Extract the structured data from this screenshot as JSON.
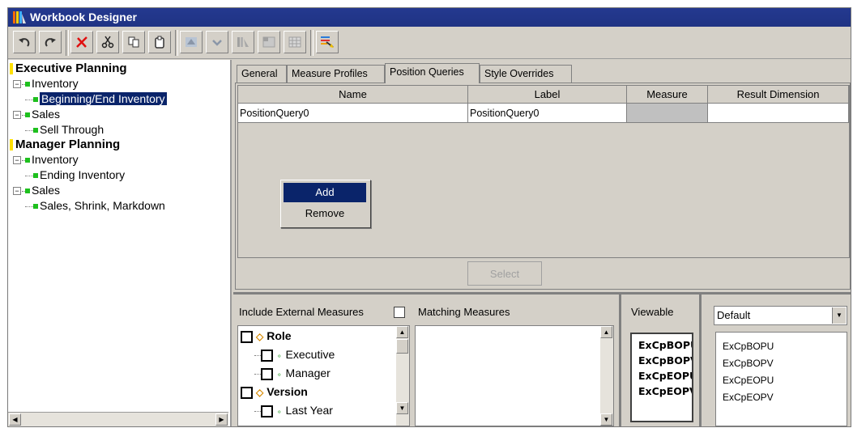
{
  "window": {
    "title": "Workbook Designer"
  },
  "toolbar": {
    "buttons": [
      "undo-icon",
      "redo-icon",
      "delete-icon",
      "cut-icon",
      "copy-icon",
      "paste-icon",
      "move-up-icon",
      "move-down-icon",
      "library-icon",
      "layout-icon",
      "grid-icon",
      "measure-icon"
    ]
  },
  "tree": {
    "items": [
      {
        "label": "Executive Planning",
        "level": 0
      },
      {
        "label": "Inventory",
        "level": 1
      },
      {
        "label": "Beginning/End Inventory",
        "level": 2
      },
      {
        "label": "Sales",
        "level": 1
      },
      {
        "label": "Sell Through",
        "level": 2
      },
      {
        "label": "Manager Planning",
        "level": 0
      },
      {
        "label": "Inventory",
        "level": 1
      },
      {
        "label": "Ending Inventory",
        "level": 2
      },
      {
        "label": "Sales",
        "level": 1
      },
      {
        "label": "Sales, Shrink, Markdown",
        "level": 2
      }
    ]
  },
  "tabs": [
    "General",
    "Measure Profiles",
    "Position Queries",
    "Style Overrides"
  ],
  "active_tab": "Position Queries",
  "grid": {
    "columns": [
      "Name",
      "Label",
      "Measure",
      "Result Dimension"
    ],
    "rows": [
      [
        "PositionQuery0",
        "PositionQuery0",
        "",
        ""
      ]
    ]
  },
  "context_menu": {
    "items": [
      "Add",
      "Remove"
    ]
  },
  "select_button": "Select",
  "bottom": {
    "include_external": "Include External Measures",
    "matching_measures": "Matching Measures",
    "viewable": "Viewable",
    "role_tree": [
      {
        "label": "Role",
        "level": 0
      },
      {
        "label": "Executive",
        "level": 1
      },
      {
        "label": "Manager",
        "level": 1
      },
      {
        "label": "Version",
        "level": 0
      },
      {
        "label": "Last Year",
        "level": 1
      }
    ],
    "viewable_items": [
      "ExCpBOPU",
      "ExCpBOPV",
      "ExCpEOPU",
      "ExCpEOPV"
    ],
    "profile_combo": "Default",
    "profile_items": [
      "ExCpBOPU",
      "ExCpBOPV",
      "ExCpEOPU",
      "ExCpEOPV"
    ]
  }
}
